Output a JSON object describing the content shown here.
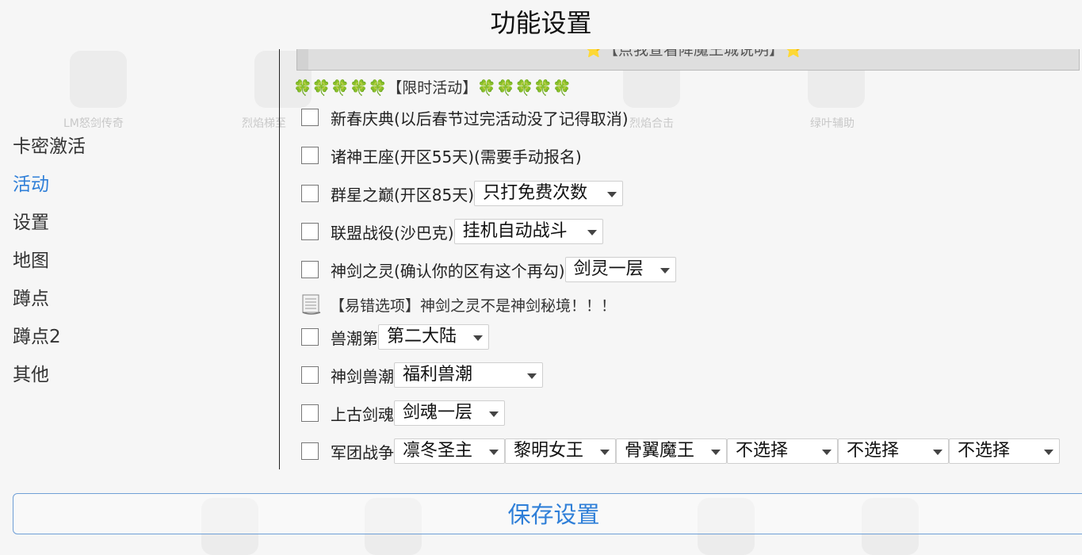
{
  "title": "功能设置",
  "background_apps": [
    "LM怒剑传奇",
    "烈焰梯至",
    "烈焰合击",
    "绿叶辅助"
  ],
  "sidebar": {
    "items": [
      {
        "label": "卡密激活",
        "active": false
      },
      {
        "label": "活动",
        "active": true
      },
      {
        "label": "设置",
        "active": false
      },
      {
        "label": "地图",
        "active": false
      },
      {
        "label": "蹲点",
        "active": false
      },
      {
        "label": "蹲点2",
        "active": false
      },
      {
        "label": "其他",
        "active": false
      }
    ]
  },
  "top_banner": "⭐【点我查看降魔王城说明】⭐",
  "section": {
    "clovers_left": "🍀🍀🍀🍀🍀",
    "title": "【限时活动】",
    "clovers_right": "🍀🍀🍀🍀🍀"
  },
  "rows": [
    {
      "label": "新春庆典(以后春节过完活动没了记得取消)",
      "checked": false
    },
    {
      "label": "诸神王座(开区55天)(需要手动报名)",
      "checked": false
    },
    {
      "label": "群星之巅(开区85天)",
      "checked": false,
      "select": "只打免费次数"
    },
    {
      "label": "联盟战役(沙巴克)",
      "checked": false,
      "select": "挂机自动战斗"
    },
    {
      "label": "神剑之灵(确认你的区有这个再勾)",
      "checked": false,
      "select": "剑灵一层"
    },
    {
      "label": "兽潮第",
      "checked": false,
      "select": "第二大陆"
    },
    {
      "label": "神剑兽潮",
      "checked": false,
      "select": "福利兽潮"
    },
    {
      "label": "上古剑魂",
      "checked": false,
      "select": "剑魂一层"
    },
    {
      "label": "军团战争",
      "checked": false,
      "selects": [
        "凛冬圣主",
        "黎明女王",
        "骨翼魔王",
        "不选择",
        "不选择",
        "不选择"
      ]
    }
  ],
  "note": "【易错选项】神剑之灵不是神剑秘境！！！",
  "save_button": "保存设置",
  "colors": {
    "accent": "#2f7fd8",
    "clover": "#4aa33a",
    "button_border": "#6f9fd6"
  }
}
